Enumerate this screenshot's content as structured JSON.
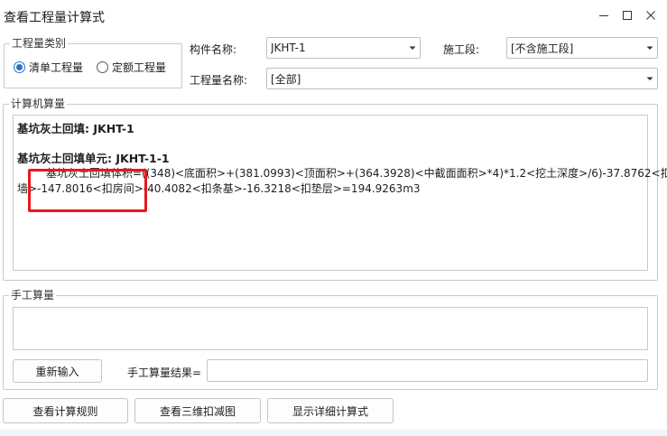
{
  "window": {
    "title": "查看工程量计算式",
    "controls": {
      "minimize": "minimize-icon",
      "maximize": "maximize-icon",
      "close": "close-icon"
    }
  },
  "category_group": {
    "label": "工程量类别",
    "options": [
      {
        "label": "清单工程量",
        "selected": true
      },
      {
        "label": "定额工程量",
        "selected": false
      }
    ]
  },
  "fields": {
    "component_name_label": "构件名称:",
    "component_name_value": "JKHT-1",
    "construction_stage_label": "施工段:",
    "construction_stage_value": "[不含施工段]",
    "quantity_name_label": "工程量名称:",
    "quantity_name_value": "[全部]"
  },
  "computer_calc": {
    "label": "计算机算量",
    "line1": "基坑灰土回填: JKHT-1",
    "line2": "基坑灰土回填单元: JKHT-1-1",
    "line3": "基坑灰土回填体积=((348)<底面积>+(381.0993)<顶面积>+(364.3928)<中截面面积>*4)*1.2<挖土深度>/6)-37.8762<扣",
    "line4": "墙>-147.8016<扣房间>-40.4082<扣条基>-16.3218<扣垫层>=194.9263m3"
  },
  "manual_calc": {
    "label": "手工算量",
    "reinput_button": "重新输入",
    "result_label": "手工算量结果=",
    "result_value": ""
  },
  "buttons": {
    "view_rules": "查看计算规则",
    "view_3d": "查看三维扣减图",
    "show_detail": "显示详细计算式"
  },
  "colors": {
    "accent": "#2f6fc8",
    "annotation": "#e8181c"
  }
}
